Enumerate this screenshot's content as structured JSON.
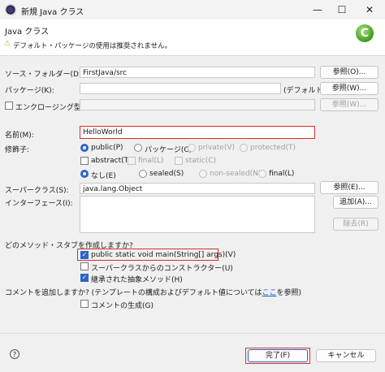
{
  "window": {
    "title": "新規 Java クラス",
    "minimize": "—",
    "maximize": "☐",
    "close": "✕"
  },
  "header": {
    "title": "Java クラス",
    "warning": "デフォルト・パッケージの使用は推奨されません。"
  },
  "form": {
    "source_folder_label": "ソース・フォルダー(D):",
    "source_folder_value": "FirstJava/src",
    "browse1": "参照(O)...",
    "package_label": "パッケージ(K):",
    "package_value": "",
    "package_default": "(デフォルト)",
    "browse2": "参照(W)...",
    "enclosing_label": "エンクロージング型(Y):",
    "enclosing_value": "",
    "browse3": "参照(W)...",
    "name_label": "名前(M):",
    "name_value": "HelloWorld",
    "modifiers_label": "修飾子:",
    "mod_public": "public(P)",
    "mod_package": "パッケージ(C)",
    "mod_private": "private(V)",
    "mod_protected": "protected(T)",
    "mod_abstract": "abstract(T)",
    "mod_final": "final(L)",
    "mod_static": "static(C)",
    "mod_none": "なし(E)",
    "mod_sealed": "sealed(S)",
    "mod_nonsealed": "non-sealed(N)",
    "mod_final2": "final(L)",
    "superclass_label": "スーパークラス(S):",
    "superclass_value": "java.lang.Object",
    "browse4": "参照(E)...",
    "interfaces_label": "インターフェース(I):",
    "add": "追加(A)...",
    "remove": "除去(R)",
    "stubs_question": "どのメソッド・スタブを作成しますか?",
    "stub_main": "public static void main(String[] args)(V)",
    "stub_constructors": "スーパークラスからのコンストラクター(U)",
    "stub_inherited": "継承された抽象メソッド(H)",
    "comments_question_pre": "コメントを追加しますか? (テンプレートの構成およびデフォルト値については",
    "comments_link": "ここ",
    "comments_question_post": "を参照)",
    "generate_comments": "コメントの生成(G)"
  },
  "footer": {
    "help": "?",
    "finish": "完了(F)",
    "cancel": "キャンセル"
  },
  "colors": {
    "accent": "#2b65c8",
    "highlight": "#d9302c"
  }
}
